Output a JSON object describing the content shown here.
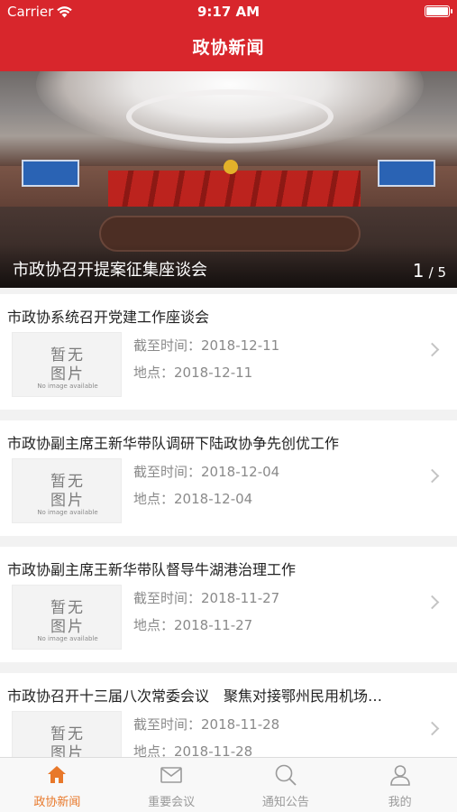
{
  "status_bar": {
    "carrier": "Carrier",
    "time": "9:17 AM"
  },
  "nav": {
    "title": "政协新闻"
  },
  "banner": {
    "caption": "市政协召开提案征集座谈会",
    "page_current": "1",
    "page_total": "/ 5"
  },
  "placeholder": {
    "line1": "暂无",
    "line2": "图片",
    "line3": "No image available"
  },
  "news": [
    {
      "title": "市政协系统召开党建工作座谈会",
      "deadline_label": "截至时间：",
      "deadline": "2018-12-11",
      "location_label": "地点：",
      "location": "2018-12-11"
    },
    {
      "title": "市政协副主席王新华带队调研下陆政协争先创优工作",
      "deadline_label": "截至时间：",
      "deadline": "2018-12-04",
      "location_label": "地点：",
      "location": "2018-12-04"
    },
    {
      "title": "市政协副主席王新华带队督导牛湖港治理工作",
      "deadline_label": "截至时间：",
      "deadline": "2018-11-27",
      "location_label": "地点：",
      "location": "2018-11-27"
    },
    {
      "title": "市政协召开十三届八次常委会议　聚焦对接鄂州民用机场…",
      "deadline_label": "截至时间：",
      "deadline": "2018-11-28",
      "location_label": "地点：",
      "location": "2018-11-28"
    }
  ],
  "tabs": [
    {
      "label": "政协新闻",
      "icon": "home-icon",
      "active": true
    },
    {
      "label": "重要会议",
      "icon": "mail-icon",
      "active": false
    },
    {
      "label": "通知公告",
      "icon": "search-icon",
      "active": false
    },
    {
      "label": "我的",
      "icon": "person-icon",
      "active": false
    }
  ],
  "colors": {
    "header": "#d8262c",
    "tab_active": "#e8782a",
    "tab_inactive": "#9a9a9a"
  }
}
